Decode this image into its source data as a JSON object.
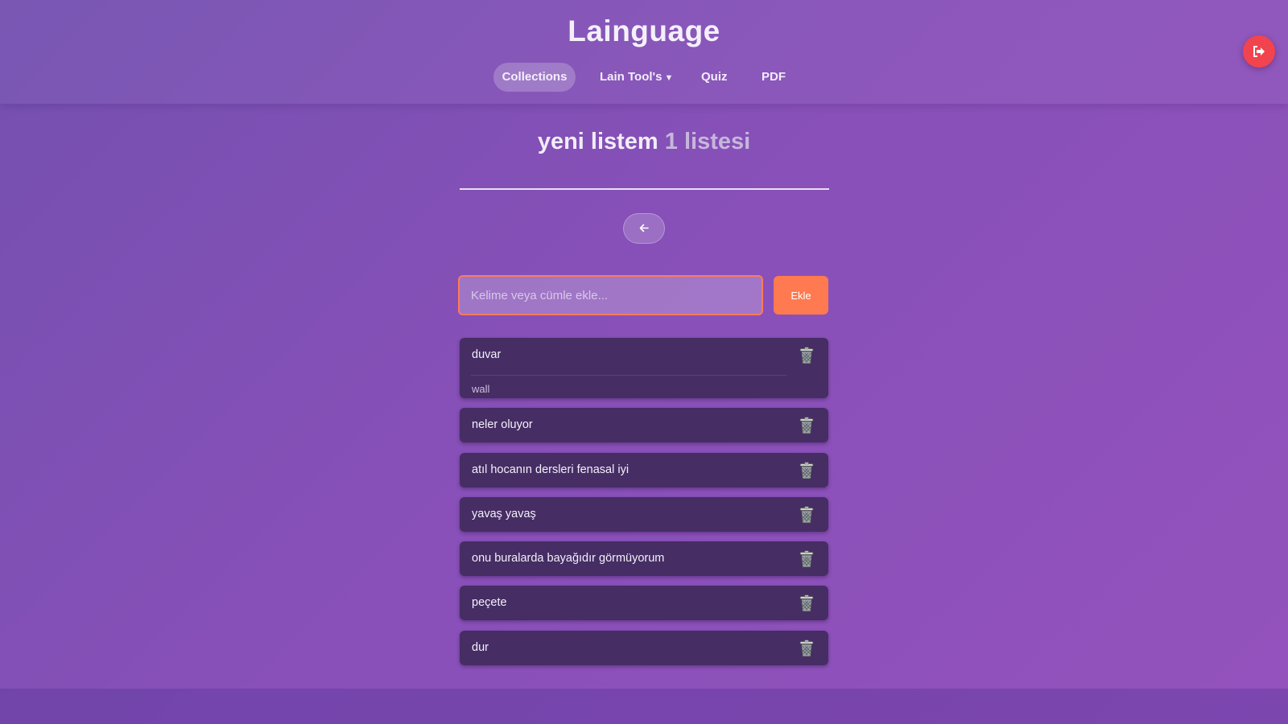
{
  "header": {
    "app_title": "Lainguage",
    "nav": [
      {
        "label": "Collections",
        "active": true
      },
      {
        "label": "Lain Tool's",
        "caret": "▼"
      },
      {
        "label": "Quiz"
      },
      {
        "label": "PDF"
      }
    ],
    "logout_icon": "logout-icon"
  },
  "list": {
    "name": "yeni listem",
    "suffix": "1 listesi"
  },
  "back_icon": "arrow-left-icon",
  "add": {
    "placeholder": "Kelime veya cümle ekle...",
    "button_label": "Ekle"
  },
  "items": [
    {
      "text": "duvar",
      "translation": "wall"
    },
    {
      "text": "neler oluyor"
    },
    {
      "text": "atıl hocanın dersleri fenasal iyi"
    },
    {
      "text": "yavaş yavaş"
    },
    {
      "text": "onu buralarda bayağıdır görmüyorum"
    },
    {
      "text": "peçete"
    },
    {
      "text": "dur"
    }
  ],
  "item_icon": "trash-icon",
  "colors": {
    "background": "#8450b6",
    "accent": "#ff7a50",
    "logout": "#f1444f",
    "card": "#462d64"
  }
}
